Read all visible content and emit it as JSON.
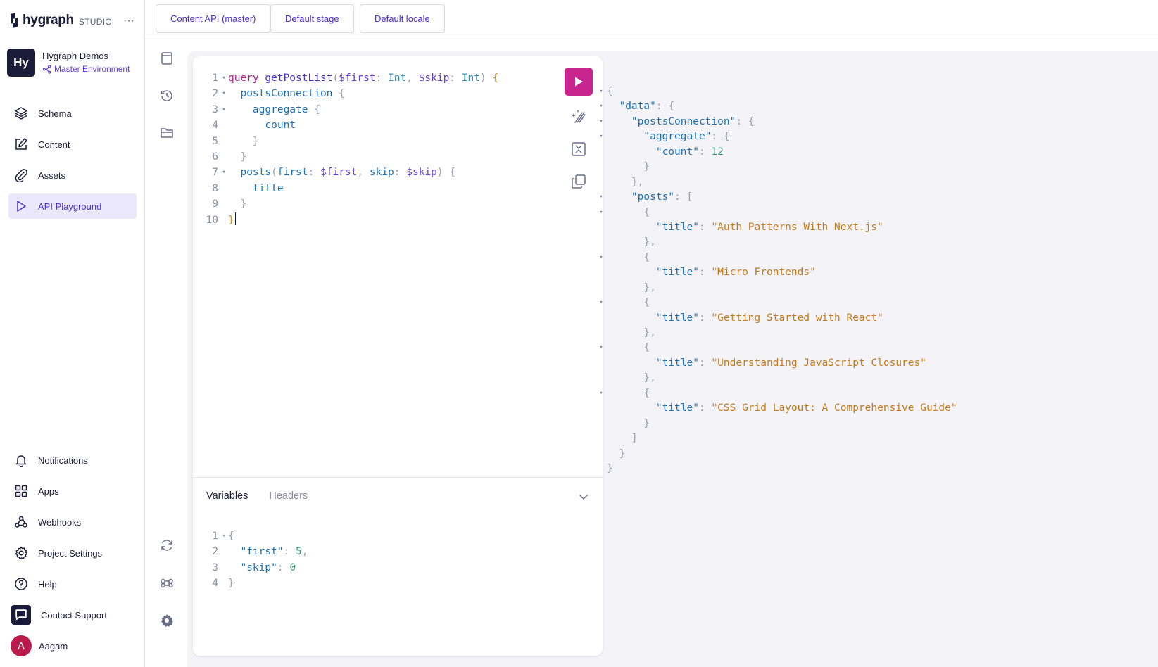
{
  "brand": {
    "name": "hygraph",
    "suffix": "STUDIO",
    "more": "···"
  },
  "project": {
    "initials": "Hy",
    "name": "Hygraph Demos",
    "environment": "Master Environment"
  },
  "nav_top": [
    {
      "label": "Schema",
      "icon": "layers-icon"
    },
    {
      "label": "Content",
      "icon": "edit-icon"
    },
    {
      "label": "Assets",
      "icon": "paperclip-icon"
    },
    {
      "label": "API Playground",
      "icon": "play-outline-icon",
      "active": true
    }
  ],
  "nav_bottom": [
    {
      "label": "Notifications",
      "icon": "bell-icon"
    },
    {
      "label": "Apps",
      "icon": "apps-grid-icon"
    },
    {
      "label": "Webhooks",
      "icon": "webhook-icon"
    },
    {
      "label": "Project Settings",
      "icon": "gear-icon"
    },
    {
      "label": "Help",
      "icon": "help-circle-icon"
    },
    {
      "label": "Contact Support",
      "icon": "chat-icon"
    },
    {
      "label": "Aagam",
      "avatar": "A"
    }
  ],
  "topbar": {
    "endpoint": "Content API (master)",
    "stage": "Default stage",
    "locale": "Default locale"
  },
  "editor": {
    "query_lines": [
      {
        "n": "1",
        "fold": true,
        "tokens": [
          [
            "kw",
            "query"
          ],
          [
            "txt",
            " "
          ],
          [
            "fn",
            "getPostList"
          ],
          [
            "pun",
            "("
          ],
          [
            "var",
            "$first"
          ],
          [
            "pun",
            ": "
          ],
          [
            "typ",
            "Int"
          ],
          [
            "pun",
            ", "
          ],
          [
            "var",
            "$skip"
          ],
          [
            "pun",
            ": "
          ],
          [
            "typ",
            "Int"
          ],
          [
            "pun",
            ") "
          ],
          [
            "brk",
            "{"
          ]
        ]
      },
      {
        "n": "2",
        "fold": true,
        "tokens": [
          [
            "txt",
            "  "
          ],
          [
            "fld",
            "postsConnection"
          ],
          [
            "txt",
            " "
          ],
          [
            "pun",
            "{"
          ]
        ]
      },
      {
        "n": "3",
        "fold": true,
        "tokens": [
          [
            "txt",
            "    "
          ],
          [
            "fld",
            "aggregate"
          ],
          [
            "txt",
            " "
          ],
          [
            "pun",
            "{"
          ]
        ]
      },
      {
        "n": "4",
        "fold": false,
        "tokens": [
          [
            "txt",
            "      "
          ],
          [
            "fld",
            "count"
          ]
        ]
      },
      {
        "n": "5",
        "fold": false,
        "tokens": [
          [
            "txt",
            "    "
          ],
          [
            "pun",
            "}"
          ]
        ]
      },
      {
        "n": "6",
        "fold": false,
        "tokens": [
          [
            "txt",
            "  "
          ],
          [
            "pun",
            "}"
          ]
        ]
      },
      {
        "n": "7",
        "fold": true,
        "tokens": [
          [
            "txt",
            "  "
          ],
          [
            "fld",
            "posts"
          ],
          [
            "pun",
            "("
          ],
          [
            "fld",
            "first"
          ],
          [
            "pun",
            ": "
          ],
          [
            "var",
            "$first"
          ],
          [
            "pun",
            ", "
          ],
          [
            "fld",
            "skip"
          ],
          [
            "pun",
            ": "
          ],
          [
            "var",
            "$skip"
          ],
          [
            "pun",
            ") "
          ],
          [
            "pun",
            "{"
          ]
        ]
      },
      {
        "n": "8",
        "fold": false,
        "tokens": [
          [
            "txt",
            "    "
          ],
          [
            "fld",
            "title"
          ]
        ]
      },
      {
        "n": "9",
        "fold": false,
        "tokens": [
          [
            "txt",
            "  "
          ],
          [
            "pun",
            "}"
          ]
        ]
      },
      {
        "n": "10",
        "fold": false,
        "tokens": [
          [
            "brk",
            "}"
          ]
        ]
      }
    ],
    "tools": [
      "prettify-icon",
      "merge-fragments-icon",
      "copy-icon"
    ]
  },
  "variables_panel": {
    "tabs": [
      "Variables",
      "Headers"
    ],
    "active_tab": "Variables",
    "lines": [
      {
        "n": "1",
        "fold": true,
        "tokens": [
          [
            "pun",
            "{"
          ]
        ]
      },
      {
        "n": "2",
        "fold": false,
        "tokens": [
          [
            "txt",
            "  "
          ],
          [
            "key",
            "\"first\""
          ],
          [
            "pun",
            ": "
          ],
          [
            "num",
            "5"
          ],
          [
            "pun",
            ","
          ]
        ]
      },
      {
        "n": "3",
        "fold": false,
        "tokens": [
          [
            "txt",
            "  "
          ],
          [
            "key",
            "\"skip\""
          ],
          [
            "pun",
            ": "
          ],
          [
            "num",
            "0"
          ]
        ]
      },
      {
        "n": "4",
        "fold": false,
        "tokens": [
          [
            "pun",
            "}"
          ]
        ]
      }
    ]
  },
  "result_lines": [
    {
      "fold": true,
      "tokens": [
        [
          "pun",
          "{"
        ]
      ]
    },
    {
      "fold": true,
      "tokens": [
        [
          "txt",
          "  "
        ],
        [
          "key",
          "\"data\""
        ],
        [
          "pun",
          ": {"
        ]
      ]
    },
    {
      "fold": true,
      "tokens": [
        [
          "txt",
          "    "
        ],
        [
          "key",
          "\"postsConnection\""
        ],
        [
          "pun",
          ": {"
        ]
      ]
    },
    {
      "fold": true,
      "tokens": [
        [
          "txt",
          "      "
        ],
        [
          "key",
          "\"aggregate\""
        ],
        [
          "pun",
          ": {"
        ]
      ]
    },
    {
      "fold": false,
      "tokens": [
        [
          "txt",
          "        "
        ],
        [
          "key",
          "\"count\""
        ],
        [
          "pun",
          ": "
        ],
        [
          "num",
          "12"
        ]
      ]
    },
    {
      "fold": false,
      "tokens": [
        [
          "txt",
          "      "
        ],
        [
          "pun",
          "}"
        ]
      ]
    },
    {
      "fold": false,
      "tokens": [
        [
          "txt",
          "    "
        ],
        [
          "pun",
          "},"
        ]
      ]
    },
    {
      "fold": true,
      "tokens": [
        [
          "txt",
          "    "
        ],
        [
          "key",
          "\"posts\""
        ],
        [
          "pun",
          ": ["
        ]
      ]
    },
    {
      "fold": true,
      "tokens": [
        [
          "txt",
          "      "
        ],
        [
          "pun",
          "{"
        ]
      ]
    },
    {
      "fold": false,
      "tokens": [
        [
          "txt",
          "        "
        ],
        [
          "key",
          "\"title\""
        ],
        [
          "pun",
          ": "
        ],
        [
          "str",
          "\"Auth Patterns With Next.js\""
        ]
      ]
    },
    {
      "fold": false,
      "tokens": [
        [
          "txt",
          "      "
        ],
        [
          "pun",
          "},"
        ]
      ]
    },
    {
      "fold": true,
      "tokens": [
        [
          "txt",
          "      "
        ],
        [
          "pun",
          "{"
        ]
      ]
    },
    {
      "fold": false,
      "tokens": [
        [
          "txt",
          "        "
        ],
        [
          "key",
          "\"title\""
        ],
        [
          "pun",
          ": "
        ],
        [
          "str",
          "\"Micro Frontends\""
        ]
      ]
    },
    {
      "fold": false,
      "tokens": [
        [
          "txt",
          "      "
        ],
        [
          "pun",
          "},"
        ]
      ]
    },
    {
      "fold": true,
      "tokens": [
        [
          "txt",
          "      "
        ],
        [
          "pun",
          "{"
        ]
      ]
    },
    {
      "fold": false,
      "tokens": [
        [
          "txt",
          "        "
        ],
        [
          "key",
          "\"title\""
        ],
        [
          "pun",
          ": "
        ],
        [
          "str",
          "\"Getting Started with React\""
        ]
      ]
    },
    {
      "fold": false,
      "tokens": [
        [
          "txt",
          "      "
        ],
        [
          "pun",
          "},"
        ]
      ]
    },
    {
      "fold": true,
      "tokens": [
        [
          "txt",
          "      "
        ],
        [
          "pun",
          "{"
        ]
      ]
    },
    {
      "fold": false,
      "tokens": [
        [
          "txt",
          "        "
        ],
        [
          "key",
          "\"title\""
        ],
        [
          "pun",
          ": "
        ],
        [
          "str",
          "\"Understanding JavaScript Closures\""
        ]
      ]
    },
    {
      "fold": false,
      "tokens": [
        [
          "txt",
          "      "
        ],
        [
          "pun",
          "},"
        ]
      ]
    },
    {
      "fold": true,
      "tokens": [
        [
          "txt",
          "      "
        ],
        [
          "pun",
          "{"
        ]
      ]
    },
    {
      "fold": false,
      "tokens": [
        [
          "txt",
          "        "
        ],
        [
          "key",
          "\"title\""
        ],
        [
          "pun",
          ": "
        ],
        [
          "str",
          "\"CSS Grid Layout: A Comprehensive Guide\""
        ]
      ]
    },
    {
      "fold": false,
      "tokens": [
        [
          "txt",
          "      "
        ],
        [
          "pun",
          "}"
        ]
      ]
    },
    {
      "fold": false,
      "tokens": [
        [
          "txt",
          "    "
        ],
        [
          "pun",
          "]"
        ]
      ]
    },
    {
      "fold": false,
      "tokens": [
        [
          "txt",
          "  "
        ],
        [
          "pun",
          "}"
        ]
      ]
    },
    {
      "fold": false,
      "tokens": [
        [
          "pun",
          "}"
        ]
      ]
    }
  ],
  "colors": {
    "accent": "#5f3ee0",
    "run_button": "#c8258e",
    "active_nav_bg": "#ebe8fd"
  }
}
